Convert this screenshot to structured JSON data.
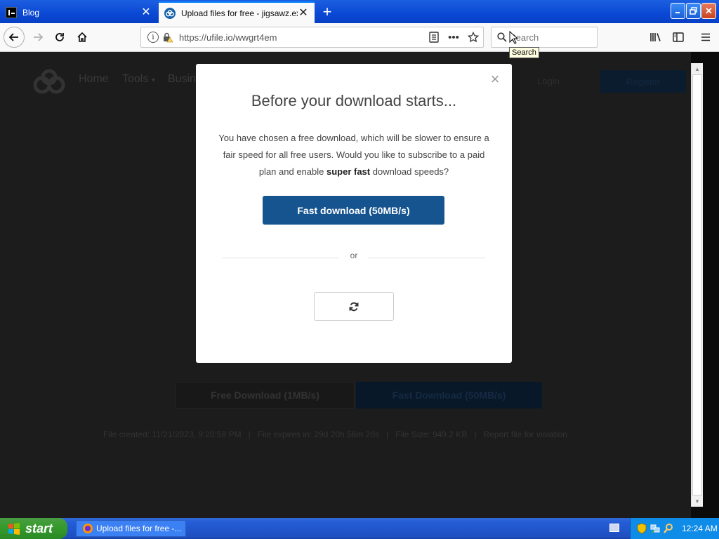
{
  "browser": {
    "tabs": [
      {
        "title": "Blog",
        "active": false
      },
      {
        "title": "Upload files for free - jigsawz.exe",
        "active": true
      }
    ],
    "url": "https://ufile.io/wwgrt4em",
    "search_placeholder": "Search",
    "tooltip": "Search"
  },
  "site": {
    "nav": {
      "home": "Home",
      "tools": "Tools",
      "business": "Busin"
    },
    "login": "Login",
    "register": "Register",
    "free_download": "Free Download (1MB/s)",
    "fast_download": "Fast Download (50MB/s)",
    "file_meta": {
      "created": "File created: 11/21/2023, 9:20:58 PM",
      "sep1": "|",
      "expires": "File expires in: 29d 20h 56m 20s",
      "sep2": "|",
      "size": "File Size: 949.2 KB",
      "sep3": "|",
      "report": "Report file for violation"
    }
  },
  "modal": {
    "title": "Before your download starts...",
    "body_part1": "You have chosen a free download, which will be slower to ensure a fair speed for all free users. Would you like to subscribe to a paid plan and enable ",
    "body_bold": "super fast",
    "body_part2": " download speeds?",
    "fast_button": "Fast download (50MB/s)",
    "or": "or",
    "close": "×"
  },
  "taskbar": {
    "start": "start",
    "task": "Upload files for free -...",
    "clock": "12:24 AM"
  },
  "colors": {
    "firefox_accent": "#0a84ff",
    "modal_button": "#16548f",
    "xp_taskbar": "#245dd7",
    "xp_start": "#379b2d"
  }
}
